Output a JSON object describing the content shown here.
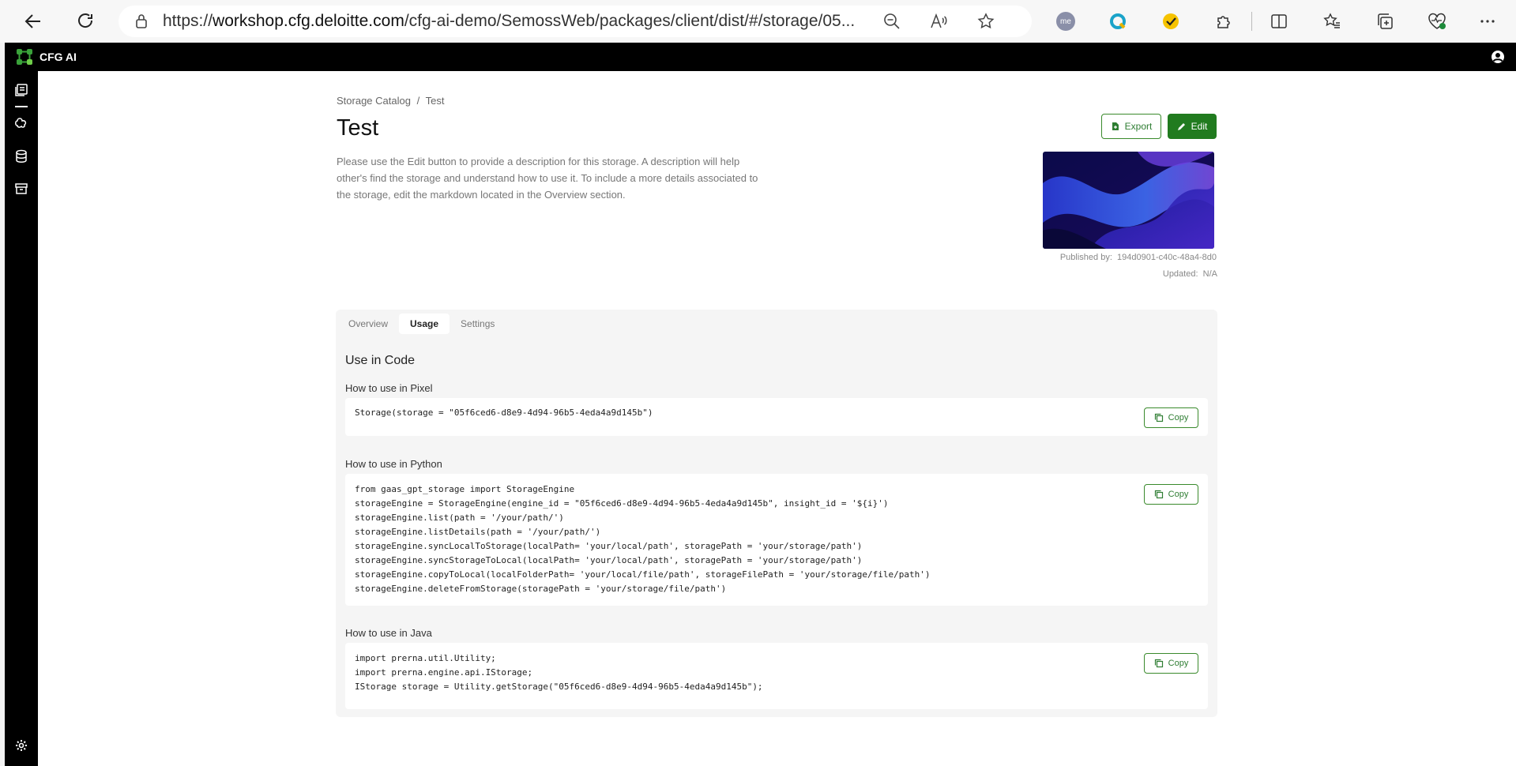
{
  "browser": {
    "url": "https://workshop.cfg.deloitte.com/cfg-ai-demo/SemossWeb/packages/client/dist/#/storage/05...",
    "url_host": "workshop.cfg.deloitte.com",
    "url_prefix": "https://",
    "url_rest": "/cfg-ai-demo/SemossWeb/packages/client/dist/#/storage/05...",
    "profile_badge": "me"
  },
  "app": {
    "name": "CFG AI",
    "brand_color": "#3aa23a"
  },
  "breadcrumb": {
    "root": "Storage Catalog",
    "separator": "/",
    "current": "Test"
  },
  "page": {
    "title": "Test",
    "description": "Please use the Edit button to provide a description for this storage. A description will help other's find the storage and understand how to use it. To include a more details associated to the storage, edit the markdown located in the Overview section."
  },
  "actions": {
    "export_label": "Export",
    "edit_label": "Edit"
  },
  "meta": {
    "published_label": "Published by:",
    "published_value": "194d0901-c40c-48a4-8d0",
    "updated_label": "Updated:",
    "updated_value": "N/A"
  },
  "tabs": [
    {
      "label": "Overview",
      "active": false
    },
    {
      "label": "Usage",
      "active": true
    },
    {
      "label": "Settings",
      "active": false
    }
  ],
  "usage": {
    "section_title": "Use in Code",
    "copy_label": "Copy",
    "pixel": {
      "label": "How to use in Pixel",
      "lines": [
        "Storage(storage = \"05f6ced6-d8e9-4d94-96b5-4eda4a9d145b\")"
      ]
    },
    "python": {
      "label": "How to use in Python",
      "lines": [
        "from gaas_gpt_storage import StorageEngine",
        "storageEngine = StorageEngine(engine_id = \"05f6ced6-d8e9-4d94-96b5-4eda4a9d145b\", insight_id = '${i}')",
        "storageEngine.list(path = '/your/path/')",
        "storageEngine.listDetails(path = '/your/path/')",
        "storageEngine.syncLocalToStorage(localPath= 'your/local/path', storagePath = 'your/storage/path')",
        "storageEngine.syncStorageToLocal(localPath= 'your/local/path', storagePath = 'your/storage/path')",
        "storageEngine.copyToLocal(localFolderPath= 'your/local/file/path', storageFilePath = 'your/storage/file/path')",
        "storageEngine.deleteFromStorage(storagePath = 'your/storage/file/path')"
      ]
    },
    "java": {
      "label": "How to use in Java",
      "lines": [
        "import prerna.util.Utility;",
        "import prerna.engine.api.IStorage;",
        "IStorage storage = Utility.getStorage(\"05f6ced6-d8e9-4d94-96b5-4eda4a9d145b\");"
      ]
    }
  }
}
